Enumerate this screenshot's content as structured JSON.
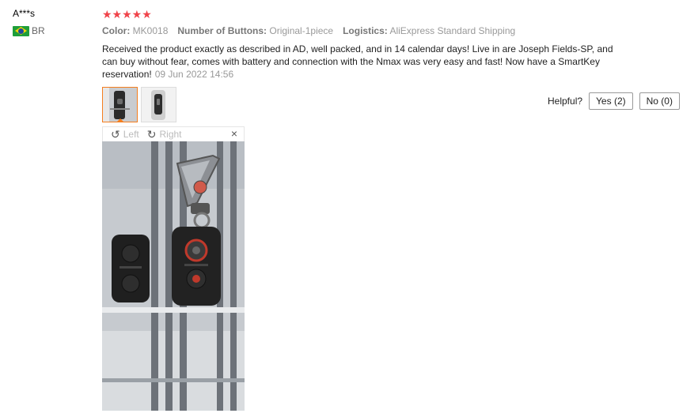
{
  "user": {
    "name": "A***s",
    "country_code": "BR",
    "flag_icon": "brazil-flag-icon"
  },
  "review": {
    "rating": 5,
    "stars": "★★★★★",
    "star_color": "#f0434a",
    "meta": [
      {
        "label": "Color:",
        "value": "MK0018"
      },
      {
        "label": "Number of Buttons:",
        "value": "Original-1piece"
      },
      {
        "label": "Logistics:",
        "value": "AliExpress Standard Shipping"
      }
    ],
    "text": "Received the product exactly as described in AD, well packed, and in 14 calendar days! Live in are Joseph Fields-SP, and can buy without fear, comes with battery and connection with the Nmax was very easy and fast! Now have a SmartKey reservation!",
    "date": "09 Jun 2022 14:56"
  },
  "helpful": {
    "label": "Helpful?",
    "yes": "Yes (2)",
    "no": "No (0)"
  },
  "viewer": {
    "left_label": "Left",
    "right_label": "Right",
    "close": "×",
    "rotate_left_icon": "↺",
    "rotate_right_icon": "↻"
  },
  "colors": {
    "accent": "#f47e1f"
  }
}
